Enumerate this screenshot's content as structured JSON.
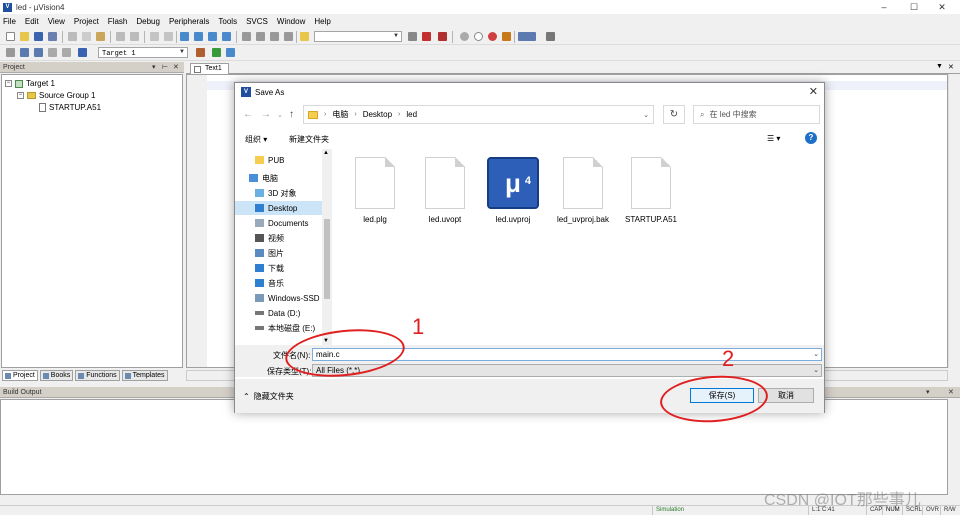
{
  "window": {
    "title": "led - µVision4",
    "icon_letter": "V",
    "min": "‒",
    "max": "☐",
    "close": "✕"
  },
  "menu": [
    "File",
    "Edit",
    "View",
    "Project",
    "Flash",
    "Debug",
    "Peripherals",
    "Tools",
    "SVCS",
    "Window",
    "Help"
  ],
  "toolbar": {
    "target_combo": "Target 1"
  },
  "project_panel": {
    "header": "Project",
    "tree": {
      "target": "Target 1",
      "group": "Source Group 1",
      "file": "STARTUP.A51"
    },
    "tabs": [
      "Project",
      "Books",
      "Functions",
      "Templates"
    ]
  },
  "editor": {
    "tab": "Text1"
  },
  "build": {
    "header": "Build Output"
  },
  "status": {
    "simulation": "Simulation",
    "position": "L:1 C:41",
    "caps": "CAP",
    "num": "NUM",
    "scrl": "SCRL",
    "ovr": "OVR",
    "rw": "R/W"
  },
  "watermark": "CSDN @IOT那些事儿",
  "dialog": {
    "title": "Save As",
    "address": {
      "segments": [
        "电脑",
        "Desktop",
        "led"
      ]
    },
    "search_placeholder": "在 led 中搜索",
    "organize": "组织 ▾",
    "new_folder": "新建文件夹",
    "nav_items": [
      "PUB",
      "电脑",
      "3D 对象",
      "Desktop",
      "Documents",
      "视频",
      "图片",
      "下载",
      "音乐",
      "Windows-SSD",
      "Data (D:)",
      "本地磁盘 (E:)"
    ],
    "files": [
      "led.plg",
      "led.uvopt",
      "led.uvproj",
      "led_uvproj.bak",
      "STARTUP.A51"
    ],
    "uv_badge": "μ",
    "uv_badge_sub": "4",
    "filename_label": "文件名(N):",
    "filename_value": "main.c",
    "filetype_label": "保存类型(T):",
    "filetype_value": "All Files (*.*)",
    "hide_folders": "隐藏文件夹",
    "save": "保存(S)",
    "cancel": "取消"
  },
  "annotations": {
    "one": "1",
    "two": "2"
  }
}
